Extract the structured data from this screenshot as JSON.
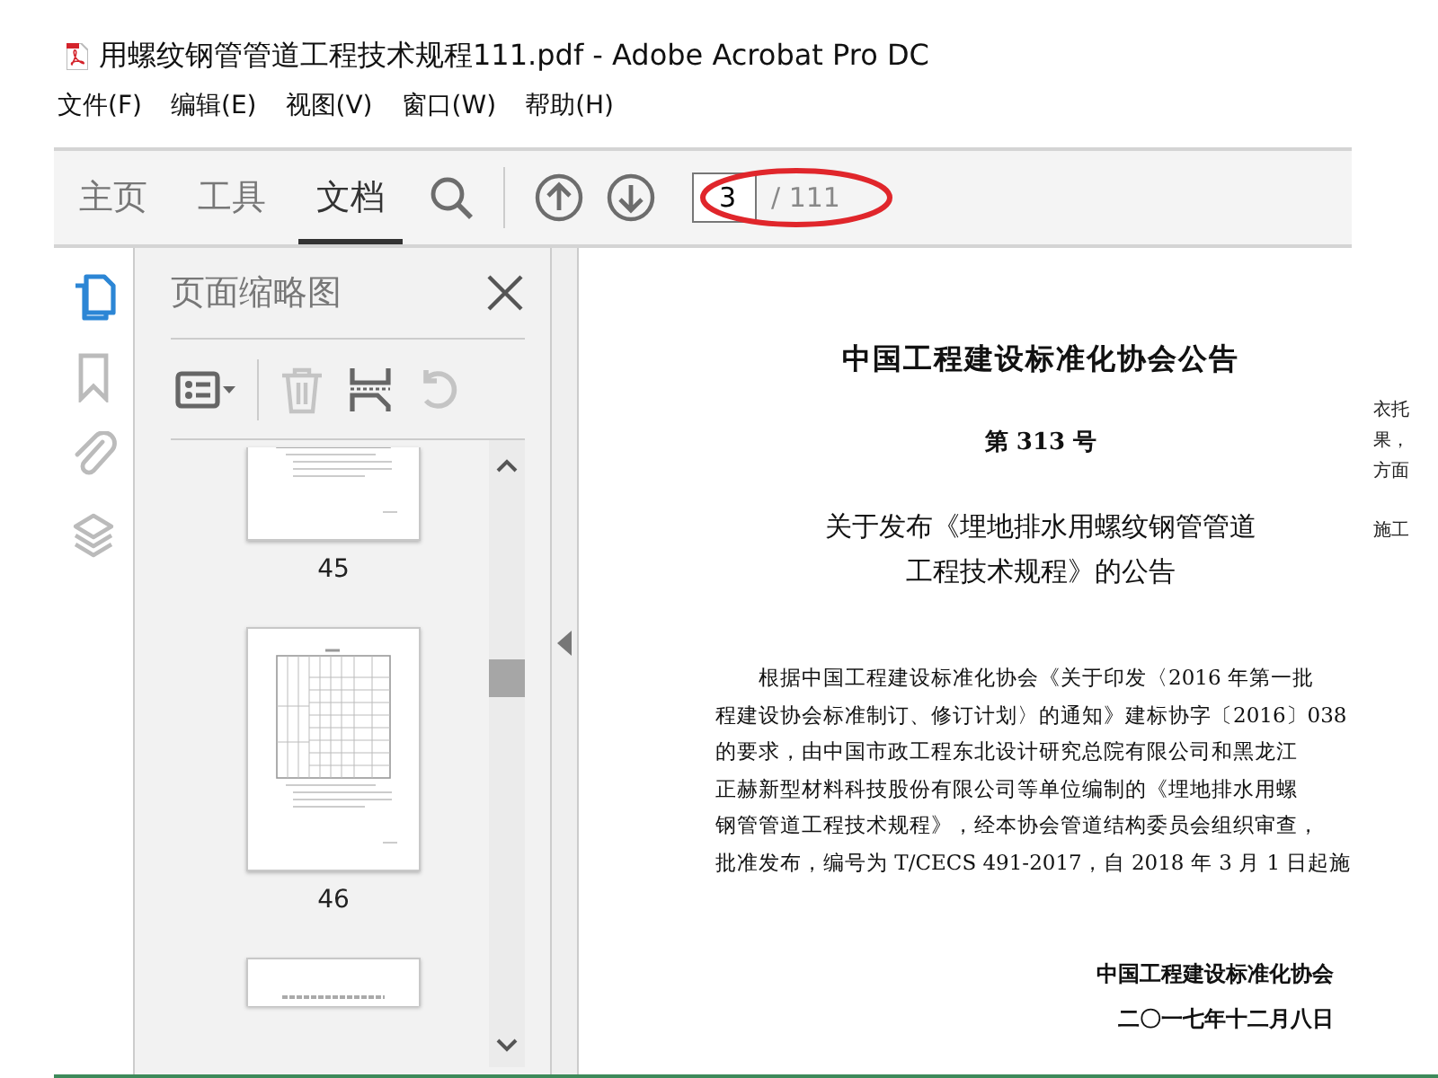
{
  "window": {
    "title": "用螺纹钢管管道工程技术规程111.pdf - Adobe Acrobat Pro DC"
  },
  "menu": [
    "文件(F)",
    "编辑(E)",
    "视图(V)",
    "窗口(W)",
    "帮助(H)"
  ],
  "tabs": [
    {
      "label": "主页",
      "selected": false
    },
    {
      "label": "工具",
      "selected": false
    },
    {
      "label": "文档",
      "selected": true
    }
  ],
  "page_nav": {
    "page": "3",
    "total": "/ 111"
  },
  "side_rail": [
    {
      "kind": "pages",
      "selected": true
    },
    {
      "kind": "bookmarks",
      "selected": false
    },
    {
      "kind": "attachments",
      "selected": false
    },
    {
      "kind": "layers",
      "selected": false
    }
  ],
  "thumbnail_panel": {
    "title": "页面缩略图",
    "tools": [
      {
        "kind": "options",
        "disabled": false
      },
      {
        "kind": "delete",
        "disabled": true
      },
      {
        "kind": "extract",
        "disabled": false
      },
      {
        "kind": "rotate",
        "disabled": true
      }
    ],
    "thumbnails": [
      {
        "kind": "bottom",
        "label": "45"
      },
      {
        "kind": "full",
        "label": "46"
      },
      {
        "kind": "top"
      }
    ]
  },
  "document": {
    "heading": "中国工程建设标准化协会公告",
    "number": "第 313 号",
    "title_lines": [
      "关于发布《埋地排水用螺纹钢管管道",
      "工程技术规程》的公告"
    ],
    "body_lines": [
      "根据中国工程建设标准化协会《关于印发〈2016 年第一批",
      "程建设协会标准制订、修订计划〉的通知》建标协字〔2016〕038",
      "的要求，由中国市政工程东北设计研究总院有限公司和黑龙江",
      "正赫新型材料科技股份有限公司等单位编制的《埋地排水用螺",
      "钢管管道工程技术规程》，经本协会管道结构委员会组织审查，",
      "批准发布，编号为 T/CECS 491-2017，自 2018 年 3 月 1 日起施"
    ],
    "signature": "中国工程建设标准化协会",
    "date": "二〇一七年十二月八日",
    "margin_fragments": [
      "衣托",
      "果，",
      "方面",
      "施工"
    ]
  }
}
